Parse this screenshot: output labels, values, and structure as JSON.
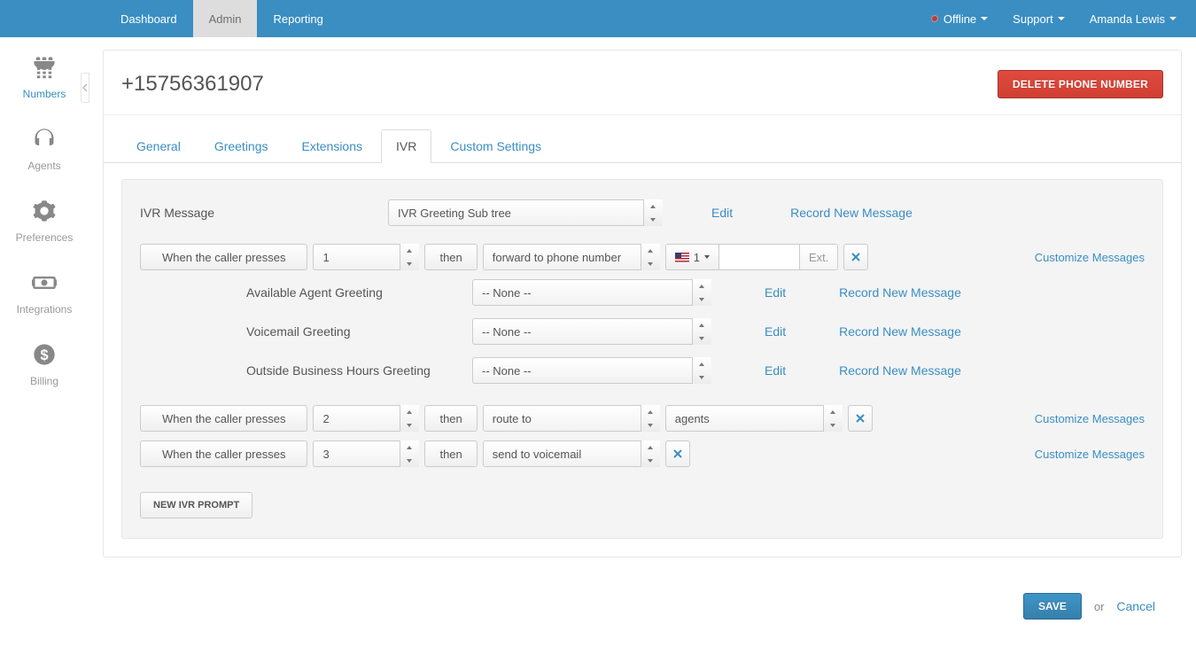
{
  "navbar": {
    "left": [
      "Dashboard",
      "Admin",
      "Reporting"
    ],
    "active_index": 1,
    "status": "Offline",
    "support": "Support",
    "user": "Amanda Lewis"
  },
  "sidebar": {
    "items": [
      {
        "label": "Numbers"
      },
      {
        "label": "Agents"
      },
      {
        "label": "Preferences"
      },
      {
        "label": "Integrations"
      },
      {
        "label": "Billing"
      }
    ],
    "active_index": 0
  },
  "page": {
    "title": "+15756361907",
    "delete_btn": "DELETE PHONE NUMBER"
  },
  "tabs": {
    "items": [
      "General",
      "Greetings",
      "Extensions",
      "IVR",
      "Custom Settings"
    ],
    "active_index": 3
  },
  "ivr": {
    "label": "IVR Message",
    "message_select": "IVR Greeting Sub tree",
    "edit": "Edit",
    "record": "Record New Message",
    "when_label": "When the caller presses",
    "then_label": "then",
    "prompts": [
      {
        "key": "1",
        "action": "forward to phone number",
        "country_code": "1",
        "phone": "",
        "ext": "Ext.",
        "customize": "Customize Messages"
      },
      {
        "key": "2",
        "action": "route to",
        "target": "agents",
        "customize": "Customize Messages"
      },
      {
        "key": "3",
        "action": "send to voicemail",
        "customize": "Customize Messages"
      }
    ],
    "greetings": [
      {
        "label": "Available Agent Greeting",
        "value": "-- None --"
      },
      {
        "label": "Voicemail Greeting",
        "value": "-- None --"
      },
      {
        "label": "Outside Business Hours Greeting",
        "value": "-- None --"
      }
    ],
    "new_prompt_btn": "NEW IVR PROMPT"
  },
  "footer": {
    "save": "SAVE",
    "or": "or",
    "cancel": "Cancel"
  }
}
